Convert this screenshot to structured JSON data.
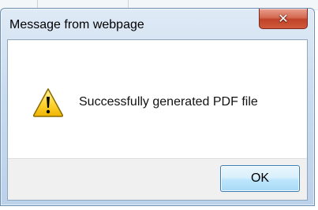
{
  "dialog": {
    "title": "Message from webpage",
    "close_icon": "close-icon",
    "message": "Successfully generated PDF file",
    "icon": "warning-icon",
    "ok_label": "OK"
  }
}
